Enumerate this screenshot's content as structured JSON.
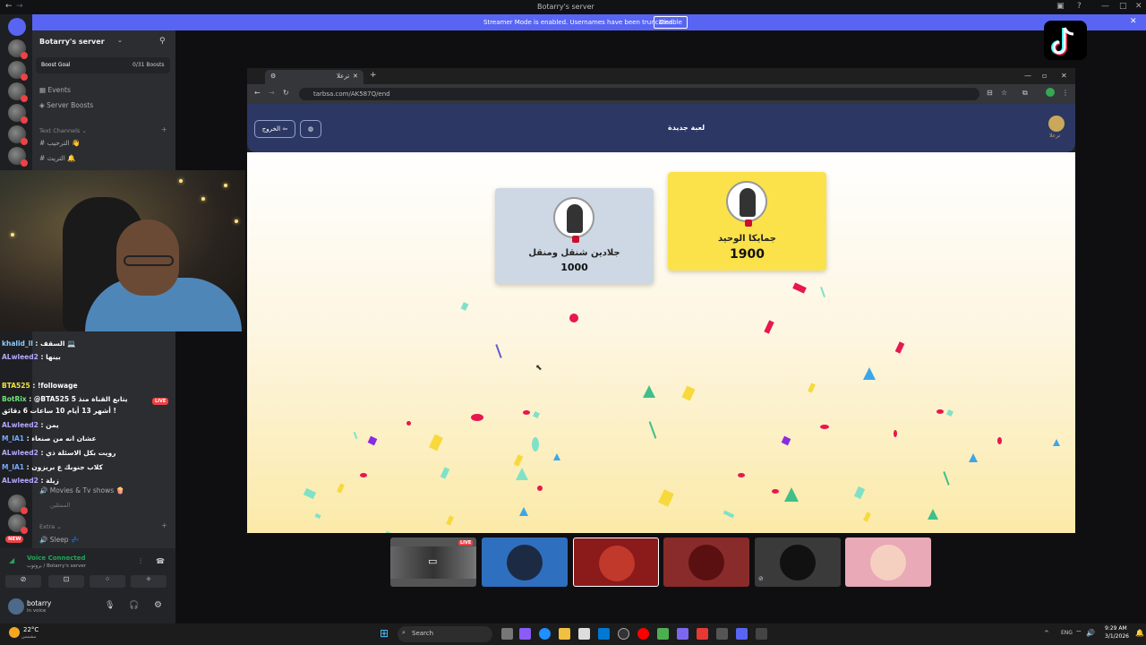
{
  "window": {
    "title": "Botarry's server",
    "controls": [
      "—",
      "□",
      "✕"
    ]
  },
  "banner": {
    "text": "Streamer Mode is enabled. Usernames have been truncated.",
    "button": "Disable",
    "close": "✕"
  },
  "server": {
    "name": "Botarry's server",
    "boost_goal": "Boost Goal",
    "boost_count": "0/31 Boosts",
    "nav": [
      {
        "icon": "calendar-icon",
        "label": "Events"
      },
      {
        "icon": "boost-icon",
        "label": "Server Boosts"
      }
    ],
    "text_category": "Text Channels",
    "text_channels": [
      "الترحيب 👋",
      "التريث 🔔"
    ],
    "voice_channels": [
      {
        "label": "Movies & Tv shows 🍿",
        "type": "voice"
      },
      {
        "label": "الممثلين",
        "type": "sub"
      },
      {
        "label": "Extra",
        "type": "category"
      },
      {
        "label": "Sleep 💤",
        "type": "voice"
      }
    ]
  },
  "chat": [
    {
      "user": "khalid_ll",
      "msg": ": السقف 💻"
    },
    {
      "user": "ALwleed2",
      "msg": ": بينها"
    },
    {
      "user": "BTA525",
      "msg": ": !followage"
    },
    {
      "user": "BotRix",
      "msg": ": @BTA525 يتابع القناة منذ 5"
    },
    {
      "user": "",
      "msg": "أشهر 13 أيام 10 ساعات 6 دقائق !"
    },
    {
      "user": "ALwleed2",
      "msg": ": يمن"
    },
    {
      "user": "M_IA1",
      "msg": ": عشان انه من صنعاء"
    },
    {
      "user": "ALwleed2",
      "msg": ": رويت بكل الاسئلة ذي"
    },
    {
      "user": "M_IA1",
      "msg": ": كلاب جنوبك ع بريزون"
    },
    {
      "user": "ALwleed2",
      "msg": ": زيلة"
    }
  ],
  "new_badge": "NEW",
  "voice_panel": {
    "status": "Voice Connected",
    "sub": "بروتوب / Botarry's server",
    "user": "botarry",
    "user_status": "In voice"
  },
  "browser": {
    "tab_title": "ترعلا",
    "url": "tarbsa.com/AK587Q/end",
    "exit_button": "الخروج",
    "page_title": "لعبة جديدة",
    "logo_text": "ترعلا",
    "cards": [
      {
        "name": "جمايكا الوحيد",
        "score": "1900",
        "winner": true
      },
      {
        "name": "جلادين شنقل ومنقل",
        "score": "1000",
        "winner": false
      }
    ]
  },
  "participants": [
    {
      "name": "screen-share",
      "live": "LIVE",
      "bg": "#444"
    },
    {
      "name": "participant-2",
      "bg": "#2f6fbf"
    },
    {
      "name": "participant-3",
      "bg": "#8b1a1a"
    },
    {
      "name": "participant-4",
      "bg": "#8a2b2b"
    },
    {
      "name": "participant-5",
      "bg": "#3a3a3a"
    },
    {
      "name": "participant-6",
      "bg": "#e9a9b6"
    }
  ],
  "taskbar": {
    "weather": "22°C",
    "weather_sub": "مشمس",
    "search": "Search",
    "lang": "ENG",
    "time": "9:29 AM",
    "date": "3/1/2026"
  }
}
